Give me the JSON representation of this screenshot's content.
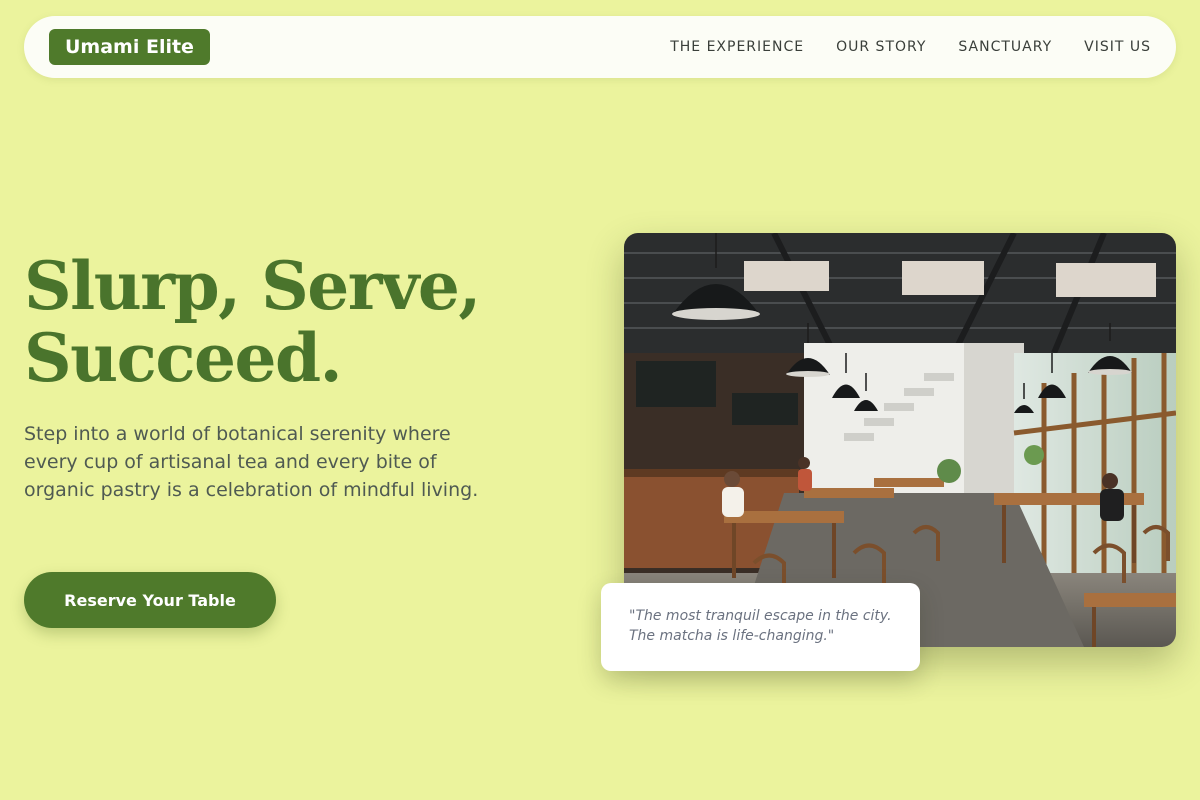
{
  "header": {
    "logo": "Umami Elite",
    "nav": [
      "THE EXPERIENCE",
      "OUR STORY",
      "SANCTUARY",
      "VISIT US"
    ]
  },
  "hero": {
    "title_line1": "Slurp, Serve,",
    "title_line2": "Succeed.",
    "description": "Step into a world of botanical serenity where every cup of artisanal tea and every bite of organic pastry is a celebration of mindful living.",
    "cta_label": "Reserve Your Table"
  },
  "testimonial": {
    "quote": "\"The most tranquil escape in the city. The matcha is life-changing.\""
  },
  "colors": {
    "background": "#ebf39d",
    "accent": "#4f7a2b",
    "title": "#4a742c",
    "body_text": "#4f5a52"
  },
  "images": {
    "hero_photo": "cafe-interior-photo"
  }
}
